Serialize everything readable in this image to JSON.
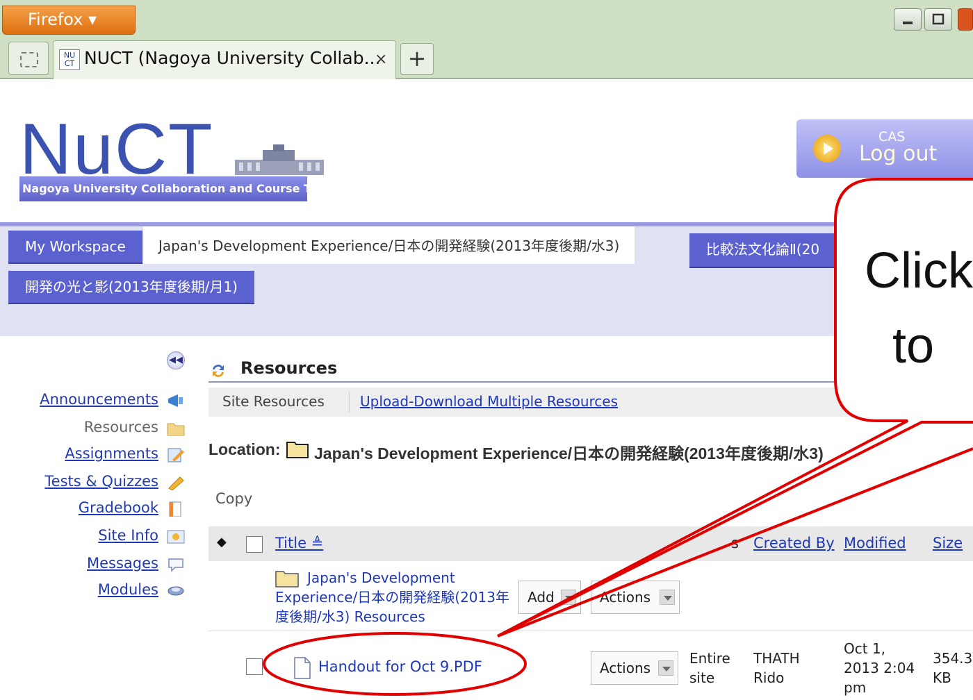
{
  "browser": {
    "menu_label": "Firefox ▾",
    "tab_title": "NUCT (Nagoya University Collab...",
    "tab_favicon": "NU CT",
    "tab_close": "×",
    "new_tab": "+"
  },
  "header": {
    "logo_text": "NuCT",
    "logo_subtitle": "Nagoya University Collaboration and Course Tools",
    "logout_small": "CAS",
    "logout_label": "Log out"
  },
  "site_tabs": {
    "workspace": "My Workspace",
    "current": "Japan's Development Experience/日本の開発経験(2013年度後期/水3)",
    "hikaku": "比較法文化論Ⅱ(20",
    "kaihatsu": "開発の光と影(2013年度後期/月1)"
  },
  "tools": [
    {
      "label": "Announcements",
      "icon": "megaphone-icon",
      "current": false
    },
    {
      "label": "Resources",
      "icon": "folder-icon",
      "current": true
    },
    {
      "label": "Assignments",
      "icon": "pencil-paper-icon",
      "current": false
    },
    {
      "label": "Tests & Quizzes",
      "icon": "pencil-icon",
      "current": false
    },
    {
      "label": "Gradebook",
      "icon": "gradebook-icon",
      "current": false
    },
    {
      "label": "Site Info",
      "icon": "site-info-icon",
      "current": false
    },
    {
      "label": "Messages",
      "icon": "speech-bubble-icon",
      "current": false
    },
    {
      "label": "Modules",
      "icon": "modules-icon",
      "current": false
    }
  ],
  "resources": {
    "title": "Resources",
    "site_resources": "Site Resources",
    "upload_link": "Upload-Download Multiple Resources",
    "location_label": "Location:",
    "location_value": "Japan's Development Experience/日本の開発経験(2013年度後期/水3)",
    "copy_label": "Copy"
  },
  "table": {
    "headers": {
      "sort": "◆",
      "title": "Title ≜",
      "access_fragment": "s",
      "created_by": "Created By",
      "modified": "Modified",
      "size": "Size"
    },
    "folder_row": {
      "title": "Japan's Development Experience/日本の開発経験(2013年度後期/水3) Resources",
      "add_label": "Add",
      "actions_label": "Actions"
    },
    "file_row": {
      "title": "Handout for Oct 9.PDF",
      "actions_label": "Actions",
      "access_line1": "Entire",
      "access_line2": "site",
      "created_line1": "THATH",
      "created_line2": "Rido",
      "modified_line1": "Oct 1,",
      "modified_line2": "2013 2:04",
      "modified_line3": "pm",
      "size_line1": "354.3",
      "size_line2": "KB"
    }
  },
  "annotation": {
    "callout_text": "Click\n  to",
    "color": "#e00000"
  },
  "colors": {
    "nav_accent": "#5c61d0",
    "link": "#1f38b3",
    "firefox_orange": "#e8841f"
  }
}
